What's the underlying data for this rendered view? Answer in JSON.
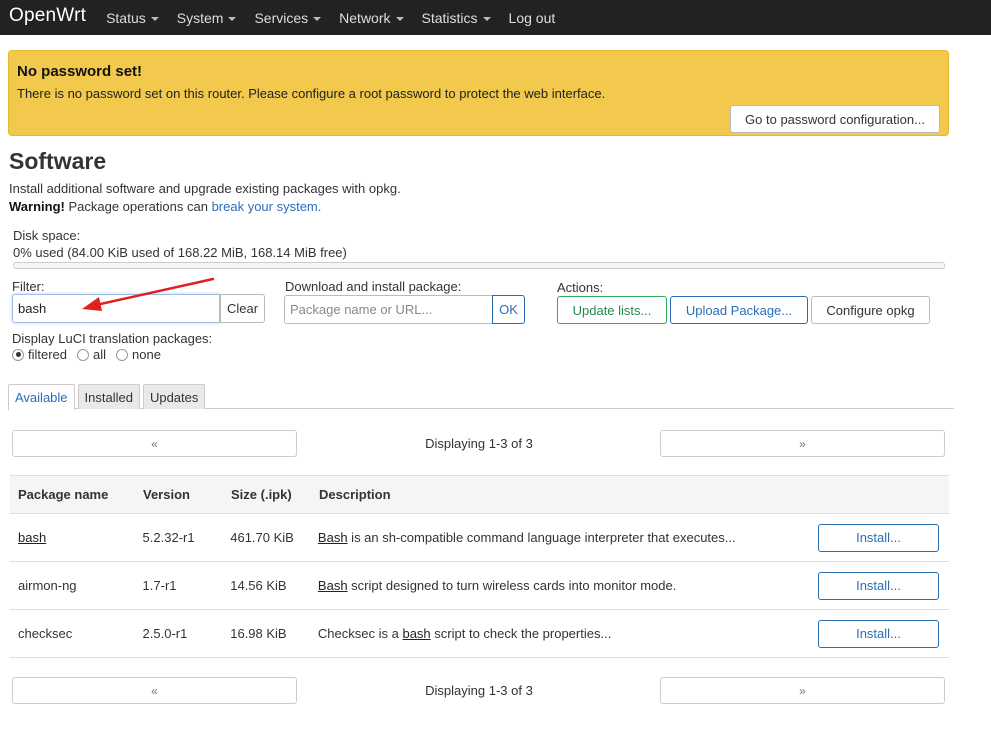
{
  "nav": {
    "brand": "OpenWrt",
    "items": [
      {
        "label": "Status",
        "dropdown": true
      },
      {
        "label": "System",
        "dropdown": true
      },
      {
        "label": "Services",
        "dropdown": true
      },
      {
        "label": "Network",
        "dropdown": true
      },
      {
        "label": "Statistics",
        "dropdown": true
      },
      {
        "label": "Log out",
        "dropdown": false
      }
    ]
  },
  "alert": {
    "title": "No password set!",
    "text": "There is no password set on this router. Please configure a root password to protect the web interface.",
    "button": "Go to password configuration..."
  },
  "page": {
    "title": "Software",
    "description": "Install additional software and upgrade existing packages with opkg.",
    "warning_bold": "Warning!",
    "warning_text": " Package operations can ",
    "warning_link": "break your system."
  },
  "disk": {
    "label": "Disk space:",
    "value": "0% used (84.00 KiB used of 168.22 MiB, 168.14 MiB free)",
    "used_percent": 0
  },
  "filter": {
    "label": "Filter:",
    "value": "bash",
    "clear": "Clear"
  },
  "download": {
    "label": "Download and install package:",
    "placeholder": "Package name or URL...",
    "ok": "OK"
  },
  "actions": {
    "label": "Actions:",
    "update_lists": "Update lists...",
    "upload_package": "Upload Package...",
    "configure_opkg": "Configure opkg"
  },
  "lang": {
    "label": "Display LuCI translation packages:",
    "options": [
      {
        "label": "filtered",
        "checked": true
      },
      {
        "label": "all",
        "checked": false
      },
      {
        "label": "none",
        "checked": false
      }
    ]
  },
  "tabs": [
    {
      "label": "Available",
      "active": true
    },
    {
      "label": "Installed",
      "active": false
    },
    {
      "label": "Updates",
      "active": false
    }
  ],
  "pager": {
    "prev": "«",
    "next": "»",
    "text": "Displaying 1-3 of 3"
  },
  "table": {
    "headers": [
      "Package name",
      "Version",
      "Size (.ipk)",
      "Description"
    ],
    "rows": [
      {
        "name": "bash",
        "version": "5.2.32-r1",
        "size": "461.70 KiB",
        "desc_pre": "",
        "desc_link": "Bash",
        "desc_post": " is an sh-compatible command language interpreter that executes...",
        "install": "Install..."
      },
      {
        "name": "airmon-ng",
        "version": "1.7-r1",
        "size": "14.56 KiB",
        "desc_pre": "",
        "desc_link": "Bash",
        "desc_post": " script designed to turn wireless cards into monitor mode.",
        "install": "Install..."
      },
      {
        "name": "checksec",
        "version": "2.5.0-r1",
        "size": "16.98 KiB",
        "desc_pre": "Checksec is a ",
        "desc_link": "bash",
        "desc_post": " script to check the properties...",
        "install": "Install..."
      }
    ]
  },
  "colors": {
    "navbar": "#222222",
    "alert": "#f2c94c",
    "accent": "#2a6ebb",
    "green": "#228b4f",
    "annotation_arrow": "#e02020"
  }
}
